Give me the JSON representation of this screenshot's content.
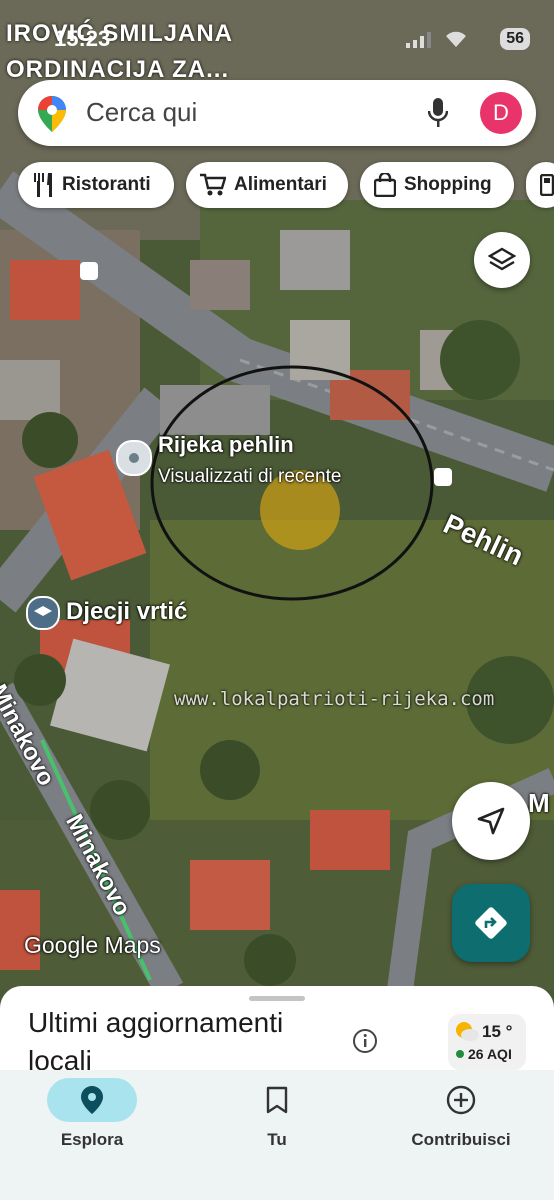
{
  "status_bar": {
    "time": "15:23",
    "battery": "56"
  },
  "overlay_title": {
    "line1": "IROVIĆ SMILJANA",
    "line2": "ORDINACIJA ZA..."
  },
  "search": {
    "placeholder": "Cerca qui",
    "avatar_letter": "D"
  },
  "chips": [
    {
      "label": "Ristoranti",
      "icon": "fork-knife-icon"
    },
    {
      "label": "Alimentari",
      "icon": "cart-icon"
    },
    {
      "label": "Shopping",
      "icon": "shopping-bag-icon"
    }
  ],
  "map": {
    "place_name": "Rijeka pehlin",
    "place_sub": "Visualizzati di recente",
    "street_pehlin": "Pehlin",
    "kindergarten": "Djecji vrtić",
    "street_minakovo_1": "Minakovo",
    "street_minakovo_2": "Minakovo",
    "street_m": "M",
    "watermark": "www.lokalpatrioti-rijeka.com",
    "google_maps": "Google Maps"
  },
  "sheet": {
    "title": "Ultimi aggiornamenti locali",
    "weather_temp": "15 °",
    "weather_aqi": "26 AQI"
  },
  "nav": [
    {
      "label": "Esplora",
      "icon": "explore-pin-icon",
      "active": true
    },
    {
      "label": "Tu",
      "icon": "bookmark-icon",
      "active": false
    },
    {
      "label": "Contribuisci",
      "icon": "plus-circle-icon",
      "active": false
    }
  ],
  "colors": {
    "accent_teal": "#0e6d6f",
    "avatar": "#e8336b",
    "nav_active": "#a9e3ee"
  }
}
